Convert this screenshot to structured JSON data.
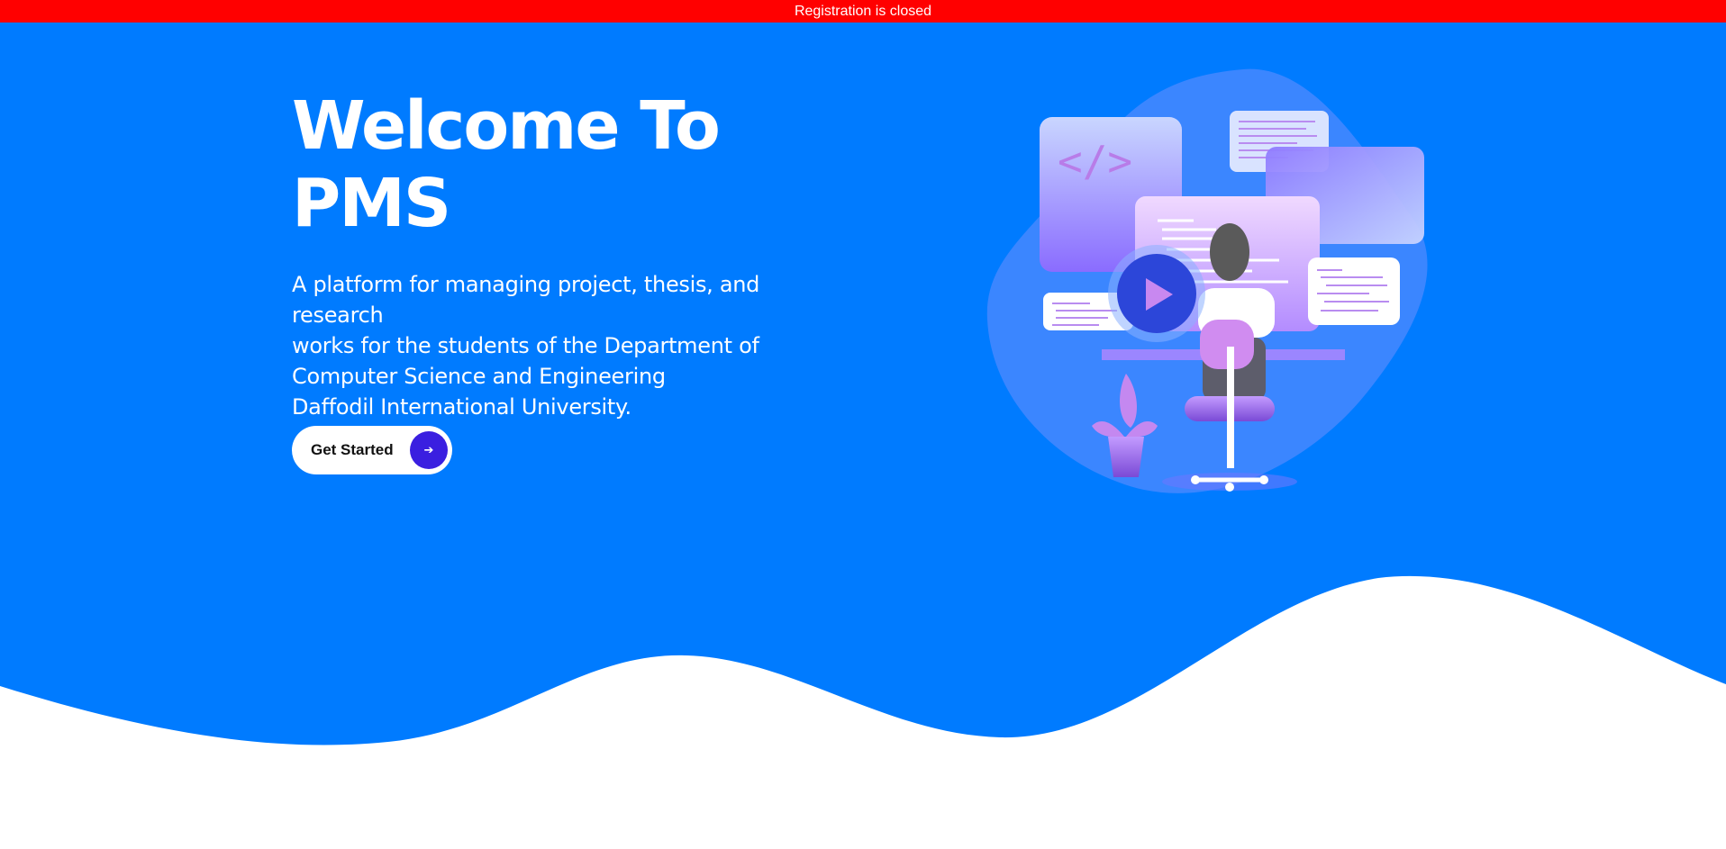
{
  "banner": {
    "text": "Registration is closed"
  },
  "hero": {
    "title_line1": "Welcome To",
    "title_line2": "PMS",
    "description_lines": [
      "A platform for managing project, thesis, and research",
      "works for the students of the Department of",
      "Computer Science and Engineering",
      "Daffodil International University."
    ],
    "cta_label": "Get Started",
    "cta_icon": "arrow-right-icon"
  },
  "illustration": {
    "code_glyph": "</>"
  },
  "colors": {
    "banner_bg": "#ff0000",
    "hero_bg": "#007bff",
    "cta_circle": "#3a1fe0",
    "wave": "#ffffff"
  }
}
